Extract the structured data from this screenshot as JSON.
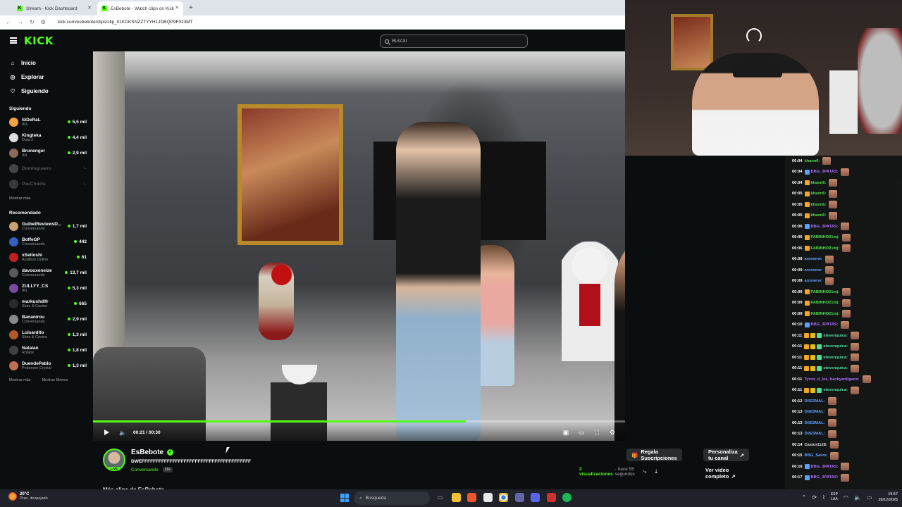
{
  "browser": {
    "tabs": [
      {
        "label": "Stream - Kick Dashboard",
        "active": false
      },
      {
        "label": "EsBebote - Watch clips on Kick",
        "active": true
      }
    ],
    "url": "kick.com/esbebote/clips/clip_01KDKSNZZTYYH1JDBQP9F023MT"
  },
  "kick": {
    "logo": "KICK",
    "search_placeholder": "Buscar",
    "nav": [
      {
        "label": "Inicio",
        "icon": "home-icon"
      },
      {
        "label": "Explorar",
        "icon": "compass-icon"
      },
      {
        "label": "Siguiendo",
        "icon": "heart-icon"
      }
    ],
    "following_title": "Siguiendo",
    "following": [
      {
        "name": "SiDeRaL",
        "category": "IRL",
        "viewers": "5,5 mil",
        "online": true,
        "color": "#f2a340"
      },
      {
        "name": "Kingteka",
        "category": "Dota 2",
        "viewers": "4,4 mil",
        "online": true,
        "color": "#dddddd"
      },
      {
        "name": "Brunenger",
        "category": "IRL",
        "viewers": "2,9 mil",
        "online": true,
        "color": "#8a6a5a"
      },
      {
        "name": "Domingueero",
        "category": "",
        "viewers": "",
        "online": false,
        "color": "#999999"
      },
      {
        "name": "PauChikita",
        "category": "",
        "viewers": "",
        "online": false,
        "color": "#777777"
      }
    ],
    "show_more": "Mostrar más",
    "recommended_title": "Recomendado",
    "recommended": [
      {
        "name": "GuibelReviewsD...",
        "category": "Conversando",
        "viewers": "1,7 mil",
        "color": "#c9a070"
      },
      {
        "name": "BoffeGP",
        "category": "Conversando",
        "viewers": "442",
        "color": "#3060c0"
      },
      {
        "name": "xSeitoshi",
        "category": "Audition Online",
        "viewers": "61",
        "color": "#c02020"
      },
      {
        "name": "davooxeneize",
        "category": "Conversando",
        "viewers": "13,7 mil",
        "color": "#5a5a5a"
      },
      {
        "name": "ZULLYY_CS",
        "category": "IRL",
        "viewers": "5,3 mil",
        "color": "#7a4aa0"
      },
      {
        "name": "markushdlfr",
        "category": "Slots & Casino",
        "viewers": "665",
        "color": "#2a2a2a"
      },
      {
        "name": "Bananirou",
        "category": "Conversando",
        "viewers": "2,9 mil",
        "color": "#8a8a8a"
      },
      {
        "name": "Luisardito",
        "category": "Slots & Casino",
        "viewers": "1,3 mil",
        "color": "#b05a2a"
      },
      {
        "name": "Natalan",
        "category": "Roblox",
        "viewers": "1,8 mil",
        "color": "#404040"
      },
      {
        "name": "DuendePablo",
        "category": "Pokemon Crystal",
        "viewers": "1,3 mil",
        "color": "#c07050"
      }
    ],
    "show_more2": "Mostrar más",
    "show_less": "Mostrar Menos"
  },
  "player": {
    "time": "00:21 / 00:30",
    "progress": 0.7
  },
  "clip": {
    "channel": "EsBebote",
    "live_badge": "LIVE",
    "title": "DWEFFFFFFFFFFFFFFFFFFFFFFFFFFFFFFFFFFFFFFF",
    "category": "Conversando",
    "age": "18+",
    "gift_button": "Regala Suscripciones",
    "customize_button": "Personaliza tu canal",
    "views": "2 visualizaciones",
    "ago": "· hace 55 segundos",
    "full_video": "Ver video completo",
    "more_clips": "Más clips de EsBebote"
  },
  "chat": [
    {
      "time": "00:04",
      "user": "khann6:",
      "color": "#4fe04f",
      "badges": [],
      "emote": true
    },
    {
      "time": "00:04",
      "user": "BBG_3PATAS:",
      "color": "#b06cff",
      "badges": [
        "#5aa0ff"
      ],
      "emote": true
    },
    {
      "time": "00:04",
      "user": "khann6:",
      "color": "#4fe04f",
      "badges": [
        "#f5a623"
      ],
      "emote": true
    },
    {
      "time": "00:05",
      "user": "khann6:",
      "color": "#4fe04f",
      "badges": [
        "#f5a623"
      ],
      "emote": true
    },
    {
      "time": "00:05",
      "user": "khann6:",
      "color": "#4fe04f",
      "badges": [
        "#f5a623"
      ],
      "emote": true
    },
    {
      "time": "00:05",
      "user": "khann6:",
      "color": "#4fe04f",
      "badges": [
        "#f5a623"
      ],
      "emote": true
    },
    {
      "time": "00:06",
      "user": "BBG_3PATAS:",
      "color": "#b06cff",
      "badges": [
        "#5aa0ff"
      ],
      "emote": true
    },
    {
      "time": "00:06",
      "user": "FABINHO21mj:",
      "color": "#4fe04f",
      "badges": [
        "#f5a623"
      ],
      "emote": true
    },
    {
      "time": "00:06",
      "user": "FABINHO21mj:",
      "color": "#4fe04f",
      "badges": [
        "#f5a623"
      ],
      "emote": true
    },
    {
      "time": "00:08",
      "user": "aronwrw:",
      "color": "#5aa0ff",
      "badges": [],
      "emote": true
    },
    {
      "time": "00:09",
      "user": "aronwrw:",
      "color": "#5aa0ff",
      "badges": [],
      "emote": true
    },
    {
      "time": "00:09",
      "user": "aronwrw:",
      "color": "#5aa0ff",
      "badges": [],
      "emote": true
    },
    {
      "time": "00:09",
      "user": "FABINHO21mj:",
      "color": "#4fe04f",
      "badges": [
        "#f5a623"
      ],
      "emote": true
    },
    {
      "time": "00:09",
      "user": "FABINHO21mj:",
      "color": "#4fe04f",
      "badges": [
        "#f5a623"
      ],
      "emote": true
    },
    {
      "time": "00:09",
      "user": "FABINHO21mj:",
      "color": "#4fe04f",
      "badges": [
        "#f5a623"
      ],
      "emote": true
    },
    {
      "time": "00:10",
      "user": "BBG_3PATAS:",
      "color": "#b06cff",
      "badges": [
        "#5aa0ff"
      ],
      "emote": true
    },
    {
      "time": "00:11",
      "user": "stevenquica:",
      "color": "#4fe0a0",
      "badges": [
        "#f5a623",
        "#e0c020",
        "#4fe0a0"
      ],
      "emote": true
    },
    {
      "time": "00:11",
      "user": "stevenquica:",
      "color": "#4fe0a0",
      "badges": [
        "#f5a623",
        "#e0c020",
        "#4fe0a0"
      ],
      "emote": true
    },
    {
      "time": "00:11",
      "user": "stevenquica:",
      "color": "#4fe0a0",
      "badges": [
        "#f5a623",
        "#e0c020",
        "#4fe0a0"
      ],
      "emote": true
    },
    {
      "time": "00:11",
      "user": "stevenquica:",
      "color": "#4fe0a0",
      "badges": [
        "#f5a623",
        "#e0c020",
        "#4fe0a0"
      ],
      "emote": true
    },
    {
      "time": "00:11",
      "user": "Tyron_d_los_backyardigans:",
      "color": "#b06cff",
      "badges": [],
      "emote": true
    },
    {
      "time": "00:11",
      "user": "stevenquica:",
      "color": "#4fe0a0",
      "badges": [
        "#f5a623",
        "#e0c020",
        "#4fe0a0"
      ],
      "emote": true
    },
    {
      "time": "00:12",
      "user": "DIIESMAL:",
      "color": "#5aa0ff",
      "badges": [],
      "emote": true
    },
    {
      "time": "00:13",
      "user": "DIIESMAL:",
      "color": "#5aa0ff",
      "badges": [],
      "emote": true
    },
    {
      "time": "00:13",
      "user": "DIIESMAL:",
      "color": "#5aa0ff",
      "badges": [],
      "emote": true
    },
    {
      "time": "00:13",
      "user": "DIIESMAL:",
      "color": "#5aa0ff",
      "badges": [],
      "emote": true
    },
    {
      "time": "00:14",
      "user": "Castor1128:",
      "color": "#dddddd",
      "badges": [],
      "emote": true
    },
    {
      "time": "00:15",
      "user": "BBG_Salvo:",
      "color": "#5aa0ff",
      "badges": [],
      "emote": true
    },
    {
      "time": "00:16",
      "user": "BBG_3PATAS:",
      "color": "#b06cff",
      "badges": [
        "#5aa0ff"
      ],
      "emote": true
    },
    {
      "time": "00:17",
      "user": "BBG_3PATAS:",
      "color": "#b06cff",
      "badges": [
        "#5aa0ff"
      ],
      "emote": true
    }
  ],
  "taskbar": {
    "weather_temp": "20°C",
    "weather_desc": "Prac. despejado",
    "search_placeholder": "Búsqueda",
    "lang_top": "ESP",
    "lang_bottom": "LAA",
    "time": "19:57",
    "date": "28/12/2025"
  },
  "colors": {
    "accent": "#53fc18"
  }
}
